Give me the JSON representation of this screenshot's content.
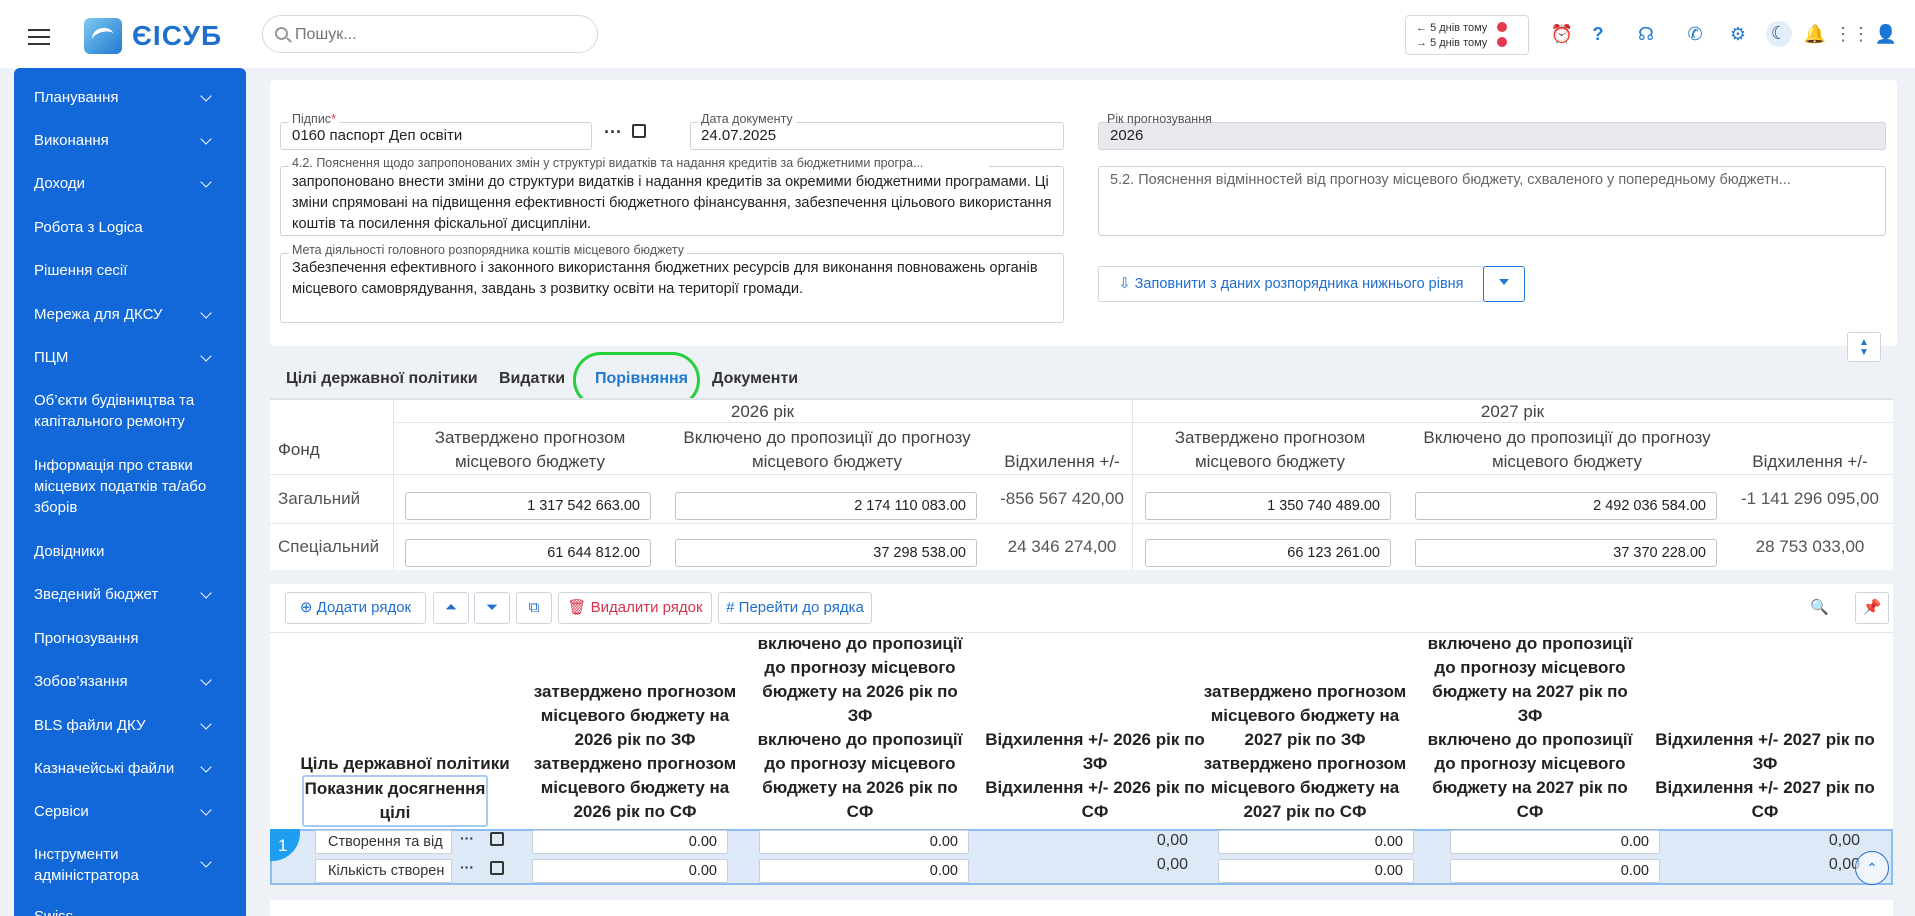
{
  "app": {
    "logo_text": "ЄІСУБ"
  },
  "search": {
    "placeholder": "Пошук..."
  },
  "notifications": {
    "line1": "5 днів тому",
    "line2": "5 днів тому"
  },
  "sidebar": {
    "items": [
      {
        "label": "Планування",
        "chevron": true
      },
      {
        "label": "Виконання",
        "chevron": true
      },
      {
        "label": "Доходи",
        "chevron": true
      },
      {
        "label": "Робота з Logica",
        "chevron": false
      },
      {
        "label": "Рішення сесії",
        "chevron": false
      },
      {
        "label": "Мережа для ДКСУ",
        "chevron": true
      },
      {
        "label": "ПЦМ",
        "chevron": true
      },
      {
        "label": "Об’єкти будівництва та капітального ремонту",
        "chevron": false
      },
      {
        "label": "Інформація про ставки місцевих податків та/або зборів",
        "chevron": false
      },
      {
        "label": "Довідники",
        "chevron": false
      },
      {
        "label": "Зведений бюджет",
        "chevron": true
      },
      {
        "label": "Прогнозування",
        "chevron": false
      },
      {
        "label": "Зобов’язання",
        "chevron": true
      },
      {
        "label": "BLS файли ДКУ",
        "chevron": true
      },
      {
        "label": "Казначейські файли",
        "chevron": true
      },
      {
        "label": "Сервіси",
        "chevron": true
      },
      {
        "label": "Інструменти адміністратора",
        "chevron": true
      },
      {
        "label": "Swiss",
        "chevron": false
      }
    ]
  },
  "form": {
    "signature": {
      "label": "Підпис",
      "required_mark": "*",
      "value": "0160 паспорт Деп освіти"
    },
    "doc_date": {
      "label": "Дата документу",
      "value": "24.07.2025"
    },
    "forecast_year": {
      "label": "Рік прогнозування",
      "value": "2026"
    },
    "explanation_42": {
      "label": "4.2. Пояснення щодо запропонованих змін у структурі видатків та надання кредитів за бюджетними програ...",
      "value": "запропоновано внести зміни до структури видатків і надання кредитів за окремими бюджетними програмами. Ці зміни спрямовані на підвищення ефективності бюджетного фінансування, забезпечення цільового використання коштів та посилення фіскальної дисципліни."
    },
    "explanation_52": {
      "placeholder": "5.2. Пояснення відмінностей від прогнозу місцевого бюджету, схваленого у попередньому бюджетн..."
    },
    "goal": {
      "label": "Мета діяльності головного розпорядника коштів місцевого бюджету",
      "value": "Забезпечення ефективного і законного використання бюджетних ресурсів для виконання повноважень органів місцевого самоврядування, завдань з розвитку освіти на території громади."
    },
    "fill_button": "Заповнити з даних розпорядника нижнього рівня"
  },
  "tabs": [
    {
      "label": "Цілі державної політики"
    },
    {
      "label": "Видатки"
    },
    {
      "label": "Порівняння"
    },
    {
      "label": "Документи"
    }
  ],
  "comparison": {
    "year1": "2026 рік",
    "year2": "2027 рік",
    "col_fund": "Фонд",
    "col_approved": "Затверджено прогнозом місцевого бюджету",
    "col_included": "Включено до пропозиції до прогнозу місцевого бюджету",
    "col_dev": "Відхилення +/-",
    "rows": [
      {
        "fund": "Загальний",
        "a1": "1 317 542 663.00",
        "i1": "2 174 110 083.00",
        "d1": "-856 567 420,00",
        "a2": "1 350 740 489.00",
        "i2": "2 492 036 584.00",
        "d2": "-1 141 296 095,00"
      },
      {
        "fund": "Спеціальний",
        "a1": "61 644 812.00",
        "i1": "37 298 538.00",
        "d1": "24 346 274,00",
        "a2": "66 123 261.00",
        "i2": "37 370 228.00",
        "d2": "28 753 033,00"
      }
    ]
  },
  "toolbar": {
    "add": "Додати рядок",
    "delete": "Видалити рядок",
    "goto": "Перейти до рядка"
  },
  "grid": {
    "headers": {
      "goal": "Ціль державної політики",
      "indicator": "Показник досягнення цілі",
      "a26zf": "затверджено прогнозом місцевого бюджету на 2026 рік по ЗФ",
      "a26sf": "затверджено прогнозом місцевого бюджету на 2026 рік по СФ",
      "i26zf": "включено до пропозиції до прогнозу місцевого бюджету на 2026 рік по ЗФ",
      "i26sf": "включено до пропозиції до прогнозу місцевого бюджету на 2026 рік по СФ",
      "d26zf": "Відхилення +/- 2026 рік по ЗФ",
      "d26sf": "Відхилення +/- 2026 рік по СФ",
      "a27zf": "затверджено прогнозом місцевого бюджету на 2027 рік по ЗФ",
      "a27sf": "затверджено прогнозом місцевого бюджету на 2027 рік по СФ",
      "i27zf": "включено до пропозиції до прогнозу місцевого бюджету на 2027 рік по ЗФ",
      "i27sf": "включено до пропозиції до прогнозу місцевого бюджету на 2027 рік по СФ",
      "d27zf": "Відхилення +/- 2027 рік по ЗФ",
      "d27sf": "Відхилення +/- 2027 рік по СФ"
    },
    "row": {
      "num": "1",
      "goal_text": "Створення та від",
      "indicator_text": "Кількість створен",
      "v1": "0.00",
      "v2": "0.00",
      "v3": "0,00",
      "v4": "0.00",
      "v5": "0.00",
      "v6": "0,00",
      "v7": "0.00",
      "v8": "0.00",
      "v9": "0,00",
      "v10": "0.00",
      "v11": "0.00",
      "v12": "0,00"
    }
  }
}
